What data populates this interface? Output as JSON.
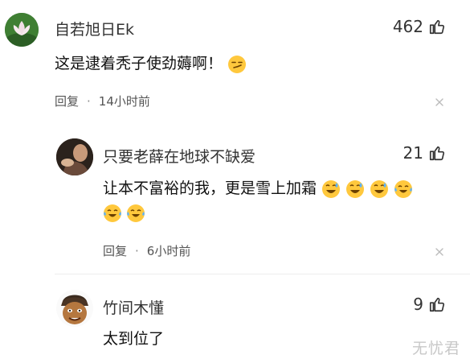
{
  "comments": [
    {
      "username": "自若旭日Ek",
      "likes": "462",
      "text": "这是逮着秃子使劲薅啊！",
      "emojis": [
        "smirk-face-emoji"
      ],
      "reply_label": "回复",
      "time": "14小时前"
    },
    {
      "username": "只要老薛在地球不缺爱",
      "likes": "21",
      "text": "让本不富裕的我，更是雪上加霜",
      "emojis": [
        "grin-sweat-emoji",
        "grin-sweat-emoji",
        "grin-sweat-emoji",
        "crying-laugh-emoji",
        "crying-laugh-emoji",
        "crying-laugh-emoji"
      ],
      "reply_label": "回复",
      "time": "6小时前"
    },
    {
      "username": "竹间木懂",
      "likes": "9",
      "text": "太到位了"
    }
  ],
  "watermark": "无忧君",
  "colors": {
    "text": "#222222",
    "meta": "#555555",
    "emoji": "#ffc83d"
  }
}
